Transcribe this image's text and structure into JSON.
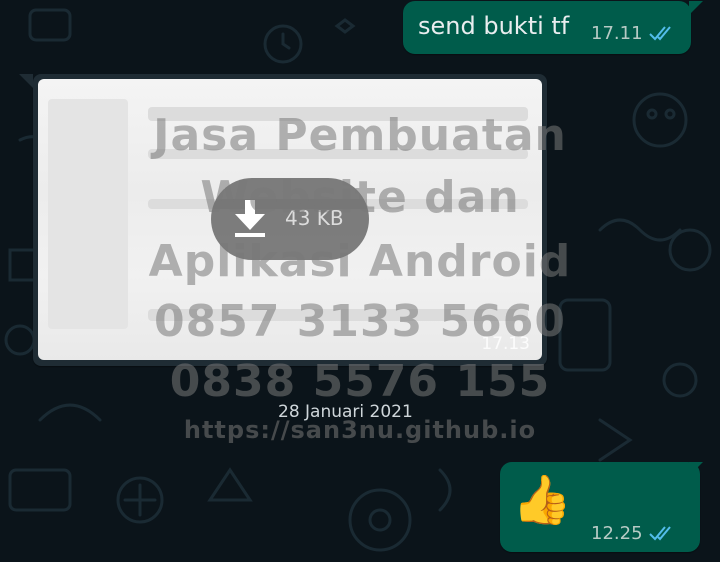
{
  "chat": {
    "messages": [
      {
        "type": "text",
        "direction": "outgoing",
        "text": "send bukti tf",
        "time": "17.11",
        "status": "read"
      },
      {
        "type": "image",
        "direction": "incoming",
        "download_size": "43 KB",
        "time": "17.13"
      },
      {
        "type": "date_separator",
        "text": "28 Januari 2021"
      },
      {
        "type": "emoji",
        "direction": "outgoing",
        "emoji": "👍",
        "time": "12.25",
        "status": "read"
      }
    ]
  },
  "watermark": {
    "lines": [
      "Jasa Pembuatan",
      "Website dan",
      "Aplikasi Android",
      "0857 3133 5660",
      "0838 5576 155"
    ],
    "url": "https://san3nu.github.io"
  },
  "colors": {
    "background": "#0b141a",
    "outgoing_bubble": "#005c4b",
    "read_tick": "#53bdeb",
    "text": "#e9edef"
  }
}
